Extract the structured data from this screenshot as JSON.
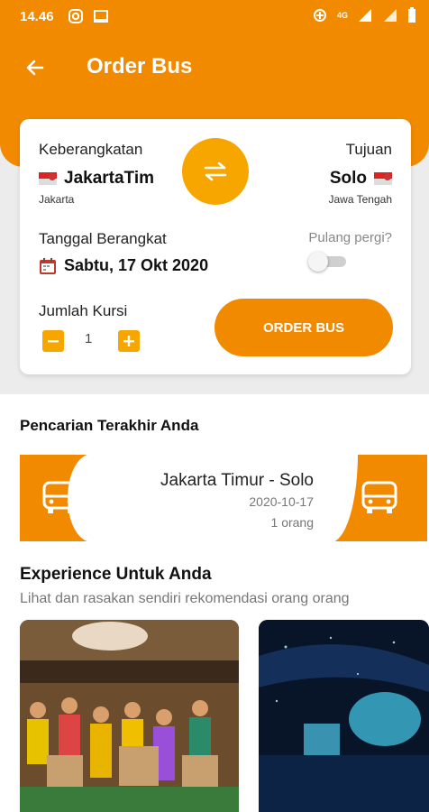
{
  "status_bar": {
    "time": "14.46",
    "network": "4G"
  },
  "header": {
    "title": "Order Bus"
  },
  "booking": {
    "origin_label": "Keberangkatan",
    "origin_city": "JakartaTim",
    "origin_region": "Jakarta",
    "destination_label": "Tujuan",
    "destination_city": "Solo",
    "destination_region": "Jawa Tengah",
    "date_label": "Tanggal Berangkat",
    "date_value": "Sabtu, 17 Okt 2020",
    "round_trip_label": "Pulang pergi?",
    "round_trip_enabled": false,
    "seats_label": "Jumlah Kursi",
    "seats_value": "1",
    "order_button": "ORDER BUS"
  },
  "recent": {
    "title": "Pencarian Terakhir Anda",
    "items": [
      {
        "route": "Jakarta Timur - Solo",
        "date": "2020-10-17",
        "passengers": "1 orang"
      }
    ]
  },
  "experience": {
    "title": "Experience Untuk Anda",
    "subtitle": "Lihat dan rasakan sendiri rekomendasi orang orang"
  },
  "colors": {
    "primary": "#f28a00",
    "accent": "#f7a600",
    "background": "#ececec"
  }
}
